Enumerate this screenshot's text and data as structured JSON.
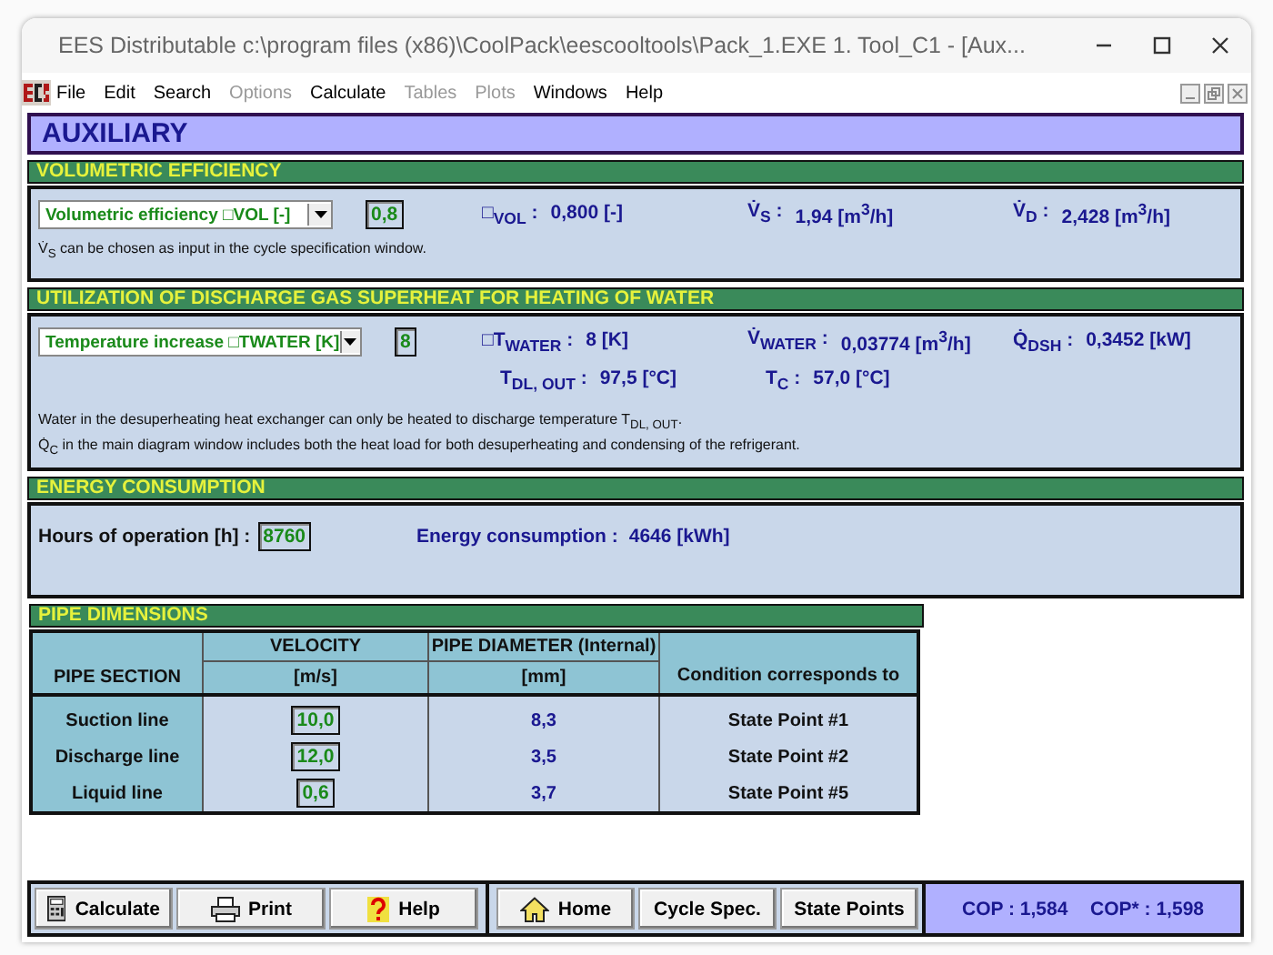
{
  "window": {
    "title": "EES Distributable  c:\\program files (x86)\\CoolPack\\eescooltools\\Pack_1.EXE   1. Tool_C1 - [Aux..."
  },
  "menu": [
    {
      "label": "File",
      "disabled": false
    },
    {
      "label": "Edit",
      "disabled": false
    },
    {
      "label": "Search",
      "disabled": false
    },
    {
      "label": "Options",
      "disabled": true
    },
    {
      "label": "Calculate",
      "disabled": false
    },
    {
      "label": "Tables",
      "disabled": true
    },
    {
      "label": "Plots",
      "disabled": true
    },
    {
      "label": "Windows",
      "disabled": false
    },
    {
      "label": "Help",
      "disabled": false
    }
  ],
  "header": {
    "title": "AUXILIARY"
  },
  "volumetric": {
    "title": "VOLUMETRIC EFFICIENCY",
    "dropdown": "Volumetric efficiency □VOL [-]",
    "input": "0,8",
    "readouts": [
      {
        "label": "□$_{VOL}$ :",
        "value": "0,800 [-]"
      },
      {
        "label": "V̇$_{S}$ :",
        "value": "1,94 [m$^{3}$/h]"
      },
      {
        "label": "V̇$_{D}$ :",
        "value": "2,428 [m$^{3}$/h]"
      }
    ],
    "note": "V̇$_{S}$ can be chosen as input in the cycle specification window."
  },
  "utilization": {
    "title": "UTILIZATION OF DISCHARGE GAS SUPERHEAT FOR HEATING OF WATER",
    "dropdown": "Temperature increase □TWATER [K]",
    "input": "8",
    "readouts": [
      {
        "label": "□T$_{WATER}$ :",
        "value": "8 [K]"
      },
      {
        "label": "V̇$_{WATER}$ :",
        "value": "0,03774 [m$^{3}$/h]"
      },
      {
        "label": "Q̇$_{DSH}$ :",
        "value": "0,3452 [kW]"
      }
    ],
    "readouts2": [
      {
        "label": "T$_{DL, OUT}$ :",
        "value": "97,5 [°C]"
      },
      {
        "label": "T$_{C}$ :",
        "value": "57,0 [°C]"
      }
    ],
    "notes": [
      "Water in the desuperheating heat exchanger can only be heated to discharge temperature T$_{DL, OUT}$.",
      "Q̇$_{C}$ in the main diagram window includes both the heat load for both desuperheating and condensing of the refrigerant."
    ]
  },
  "energy": {
    "title": "ENERGY CONSUMPTION",
    "hours_label": "Hours of operation [h] :",
    "hours": "8760",
    "consumption_label": "Energy consumption :",
    "consumption": "4646 [kWh]"
  },
  "pipes": {
    "title": "PIPE DIMENSIONS",
    "head1": [
      "VELOCITY",
      "PIPE DIAMETER (Internal)"
    ],
    "head2": [
      "PIPE SECTION",
      "[m/s]",
      "[mm]",
      "Condition corresponds to"
    ],
    "rows": [
      {
        "section": "Suction line",
        "velocity": "10,0",
        "diameter": "8,3",
        "condition": "State Point #1"
      },
      {
        "section": "Discharge line",
        "velocity": "12,0",
        "diameter": "3,5",
        "condition": "State Point #2"
      },
      {
        "section": "Liquid line",
        "velocity": "0,6",
        "diameter": "3,7",
        "condition": "State Point #5"
      }
    ]
  },
  "buttons": [
    {
      "label": "Calculate",
      "kind": "calculator"
    },
    {
      "label": "Print",
      "kind": "printer"
    },
    {
      "label": "Help",
      "kind": "help"
    },
    {
      "label": "Home",
      "kind": "home"
    },
    {
      "label": "Cycle Spec.",
      "kind": "none"
    },
    {
      "label": "State Points",
      "kind": "none"
    }
  ],
  "cop": [
    {
      "label": "COP : 1,584"
    },
    {
      "label": "COP* : 1,598"
    }
  ]
}
